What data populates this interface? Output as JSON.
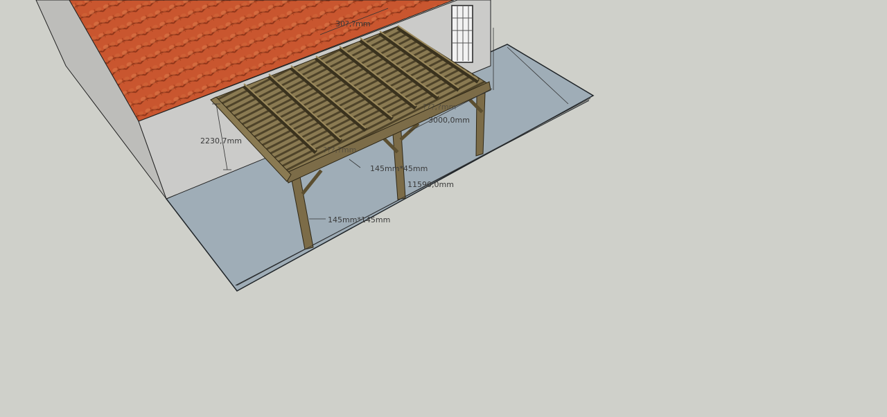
{
  "colors": {
    "background": "#cfd0ca",
    "terrace": "#9fadb7",
    "wall": "#c9c9c7",
    "roof": "#c9562f",
    "timber": "#7c6c48",
    "timber_dark": "#4e4329",
    "dimension_text": "#3a3a3a"
  },
  "dimensions": {
    "height": "2230,7mm",
    "depth": "3000,0mm",
    "length": "11590,0mm",
    "post_section": "145mm*145mm",
    "beam_section": "145mm*45mm",
    "top_spacing": "30?,?mm",
    "hidden_label_1": "???,?mm",
    "hidden_label_2": "???,?mm"
  }
}
